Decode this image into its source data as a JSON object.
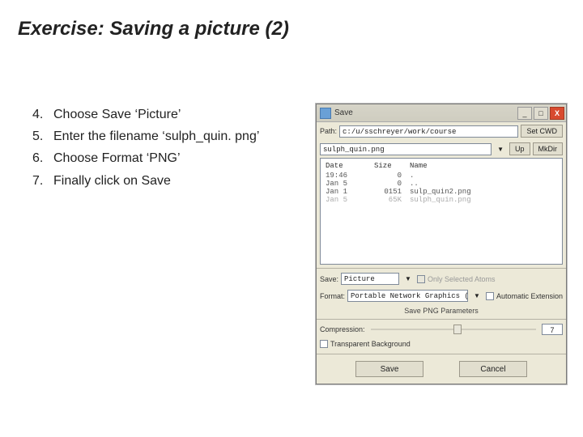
{
  "title": "Exercise: Saving a picture (2)",
  "steps": [
    {
      "num": "4.",
      "text": "Choose Save ‘Picture’"
    },
    {
      "num": "5.",
      "text": "Enter the filename ‘sulph_quin. png’"
    },
    {
      "num": "6.",
      "text": "Choose Format ‘PNG’"
    },
    {
      "num": "7.",
      "text": "Finally click on Save"
    }
  ],
  "dialog": {
    "title": "Save",
    "path_label": "Path:",
    "path_value": "c:/u/sschreyer/work/course",
    "set_cwd": "Set CWD",
    "up": "Up",
    "mkdir": "MkDir",
    "filename_value": "sulph_quin.png",
    "headers": {
      "date": "Date",
      "size": "Size",
      "name": "Name"
    },
    "files": [
      {
        "date": "19:46",
        "size": "0",
        "name": "."
      },
      {
        "date": "Jan  5",
        "size": "0",
        "name": ".."
      },
      {
        "date": "Jan  1",
        "size": "0151",
        "name": "sulp_quin2.png"
      },
      {
        "date": "Jan  5",
        "size": "65K",
        "name": "sulph_quin.png",
        "dim": true
      }
    ],
    "save_label": "Save:",
    "save_value": "Picture",
    "only_selected": "Only Selected Atoms",
    "format_label": "Format:",
    "format_value": "Portable Network Graphics (.png)",
    "auto_ext": "Automatic Extension",
    "png_params": "Save PNG Parameters",
    "compression": "Compression:",
    "compression_value": "7",
    "transparent": "Transparent Background",
    "save_btn": "Save",
    "cancel_btn": "Cancel"
  }
}
